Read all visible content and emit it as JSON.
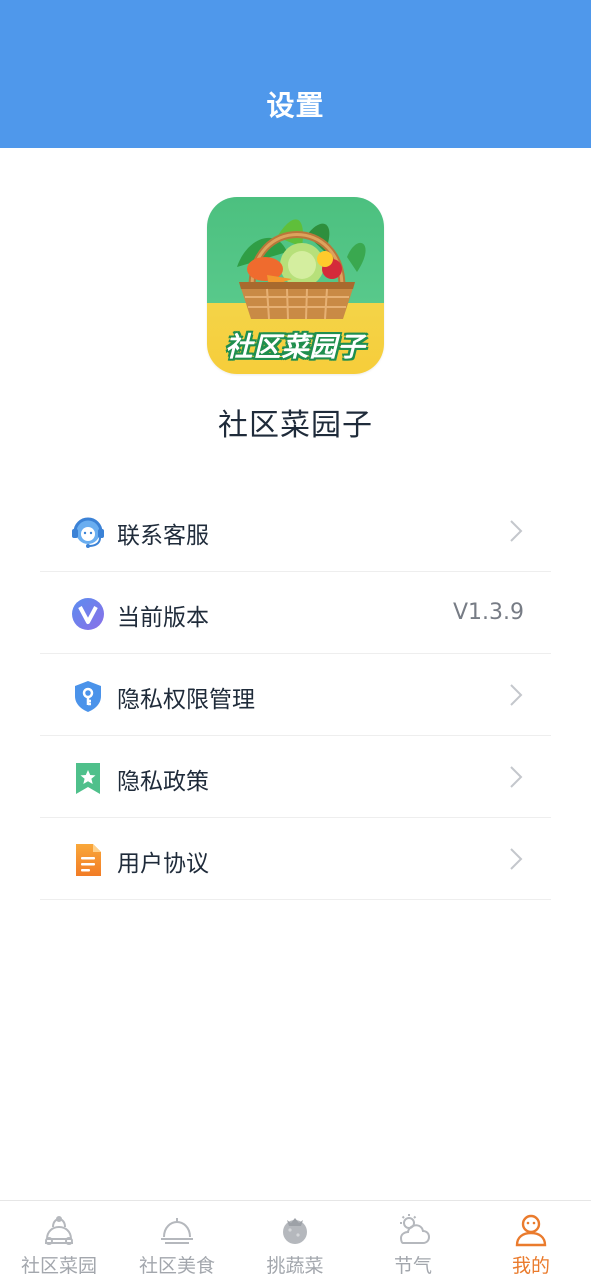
{
  "header": {
    "title": "设置"
  },
  "app": {
    "icon_text": "社区菜园子",
    "name": "社区菜园子"
  },
  "menu": {
    "items": [
      {
        "label": "联系客服",
        "icon": "customer-service-icon",
        "arrow": true
      },
      {
        "label": "当前版本",
        "icon": "version-icon",
        "value": "V1.3.9"
      },
      {
        "label": "隐私权限管理",
        "icon": "shield-key-icon",
        "arrow": true
      },
      {
        "label": "隐私政策",
        "icon": "bookmark-star-icon",
        "arrow": true
      },
      {
        "label": "用户协议",
        "icon": "document-icon",
        "arrow": true
      }
    ]
  },
  "tabbar": {
    "items": [
      {
        "label": "社区菜园",
        "icon": "garden-icon",
        "active": false
      },
      {
        "label": "社区美食",
        "icon": "food-cloche-icon",
        "active": false
      },
      {
        "label": "挑蔬菜",
        "icon": "vegetable-icon",
        "active": false
      },
      {
        "label": "节气",
        "icon": "weather-icon",
        "active": false
      },
      {
        "label": "我的",
        "icon": "user-icon",
        "active": true
      }
    ]
  },
  "colors": {
    "header_bg": "#4f98eb",
    "active_tab": "#ea7b2d",
    "inactive_tab": "#a3a7ad",
    "text_primary": "#1f2b3a"
  }
}
